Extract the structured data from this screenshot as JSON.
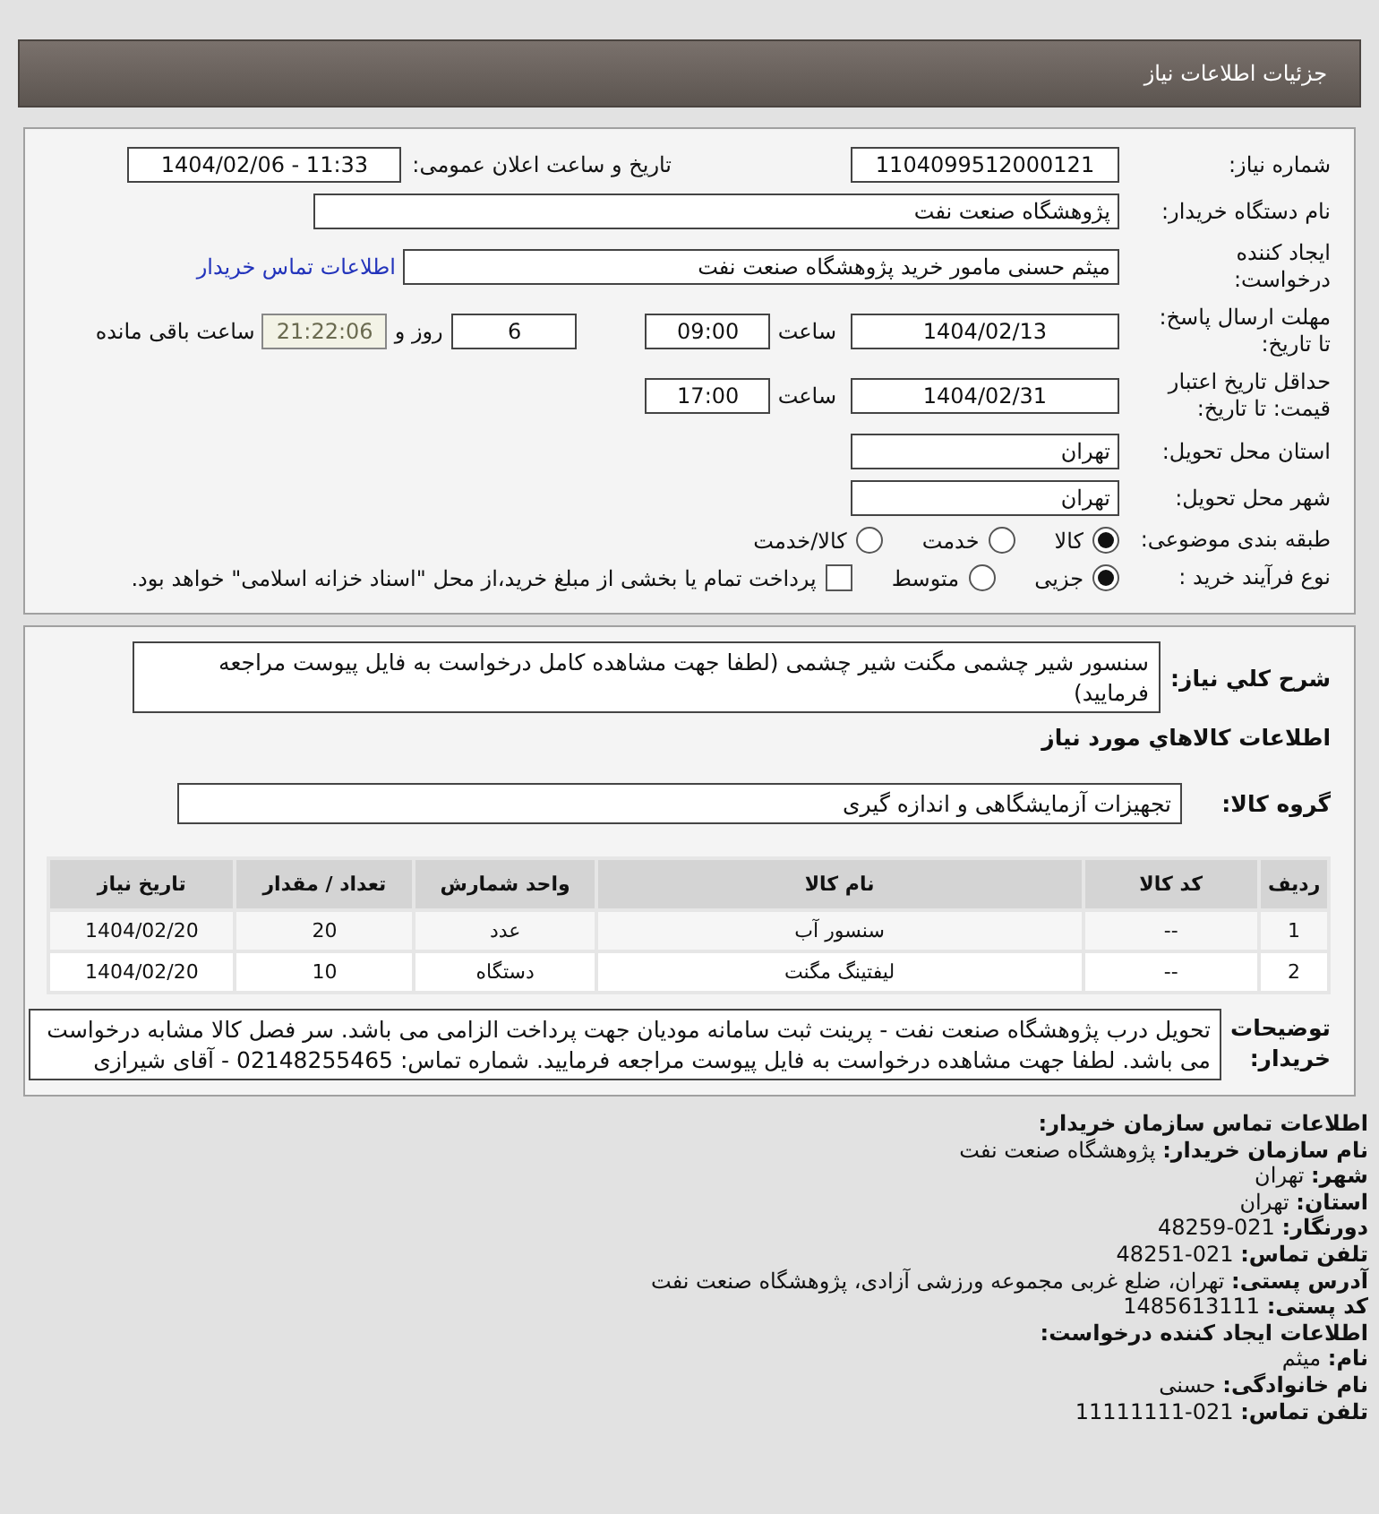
{
  "header": {
    "title": "جزئیات اطلاعات نیاز"
  },
  "details": {
    "need_number": {
      "label": "شماره نیاز:",
      "value": "1104099512000121"
    },
    "announce": {
      "label": "تاریخ و ساعت اعلان عمومی:",
      "value": "1404/02/06 - 11:33"
    },
    "buyer_org": {
      "label": "نام دستگاه خریدار:",
      "value": "پژوهشگاه صنعت نفت"
    },
    "creator": {
      "label": "ایجاد کننده\nدرخواست:",
      "value": "میثم حسنی مامور خرید پژوهشگاه صنعت نفت",
      "link": "اطلاعات تماس خریدار"
    },
    "reply_deadline": {
      "label": "مهلت ارسال پاسخ:\nتا تاریخ:",
      "date": "1404/02/13",
      "time_label": "ساعت",
      "time": "09:00",
      "days": "6",
      "days_label": "روز و",
      "remaining": "21:22:06",
      "remaining_label": "ساعت باقی مانده"
    },
    "validity": {
      "label": "حداقل تاریخ اعتبار\nقیمت: تا تاریخ:",
      "date": "1404/02/31",
      "time_label": "ساعت",
      "time": "17:00"
    },
    "province": {
      "label": "استان محل تحویل:",
      "value": "تهران"
    },
    "city": {
      "label": "شهر محل تحویل:",
      "value": "تهران"
    },
    "category": {
      "label": "طبقه بندی موضوعی:",
      "options": [
        {
          "label": "کالا",
          "selected": true
        },
        {
          "label": "خدمت",
          "selected": false
        },
        {
          "label": "کالا/خدمت",
          "selected": false
        }
      ]
    },
    "process": {
      "label": "نوع فرآیند خرید :",
      "options": [
        {
          "label": "جزیی",
          "selected": true
        },
        {
          "label": "متوسط",
          "selected": false
        }
      ],
      "payment": {
        "checked": false,
        "text": "پرداخت تمام یا بخشی از مبلغ خرید،از محل \"اسناد خزانه اسلامی\" خواهد بود."
      }
    }
  },
  "items": {
    "summary": {
      "label": "شرح کلي نياز:",
      "value": "سنسور شیر چشمی مگنت شیر چشمی (لطفا جهت مشاهده کامل درخواست به فایل پیوست مراجعه فرمایید)"
    },
    "section_title": "اطلاعات کالاهاي مورد نياز",
    "group": {
      "label": "گروه کالا:",
      "value": "تجهیزات آزمایشگاهی و اندازه گیری"
    },
    "table": {
      "columns": [
        "ردیف",
        "کد کالا",
        "نام کالا",
        "واحد شمارش",
        "تعداد / مقدار",
        "تاریخ نیاز"
      ],
      "rows": [
        [
          "1",
          "--",
          "سنسور آب",
          "عدد",
          "20",
          "1404/02/20"
        ],
        [
          "2",
          "--",
          "لیفتینگ مگنت",
          "دستگاه",
          "10",
          "1404/02/20"
        ]
      ]
    },
    "notes": {
      "label": "توضیحات\nخریدار:",
      "value": "تحویل درب پژوهشگاه صنعت نفت - پرینت ثبت سامانه مودیان جهت پرداخت الزامی می باشد. سر فصل کالا مشابه درخواست می باشد. لطفا جهت مشاهده درخواست به فایل پیوست مراجعه فرمایید. شماره تماس: 02148255465 - آقای شیرازی"
    }
  },
  "contact": [
    {
      "kind": "heading",
      "text": "اطلاعات تماس سازمان خریدار:"
    },
    {
      "kind": "field",
      "text": "**نام سازمان خریدار:** پژوهشگاه صنعت نفت"
    },
    {
      "kind": "field",
      "text": "**شهر:** تهران"
    },
    {
      "kind": "field",
      "text": "**استان:** تهران"
    },
    {
      "kind": "field",
      "text": "**دورنگار:** 021-48259"
    },
    {
      "kind": "field",
      "text": "**تلفن تماس:** 021-48251"
    },
    {
      "kind": "field",
      "text": "**آدرس پستی:** تهران، ضلع غربی مجموعه ورزشی آزادی، پژوهشگاه صنعت نفت"
    },
    {
      "kind": "field",
      "text": "**کد پستی:** 1485613111"
    },
    {
      "kind": "heading",
      "text": "اطلاعات ایجاد کننده درخواست:"
    },
    {
      "kind": "field",
      "text": "**نام:** میثم"
    },
    {
      "kind": "field",
      "text": "**نام خانوادگی:** حسنی"
    },
    {
      "kind": "field",
      "text": "**تلفن تماس:** 021-11111111"
    }
  ]
}
